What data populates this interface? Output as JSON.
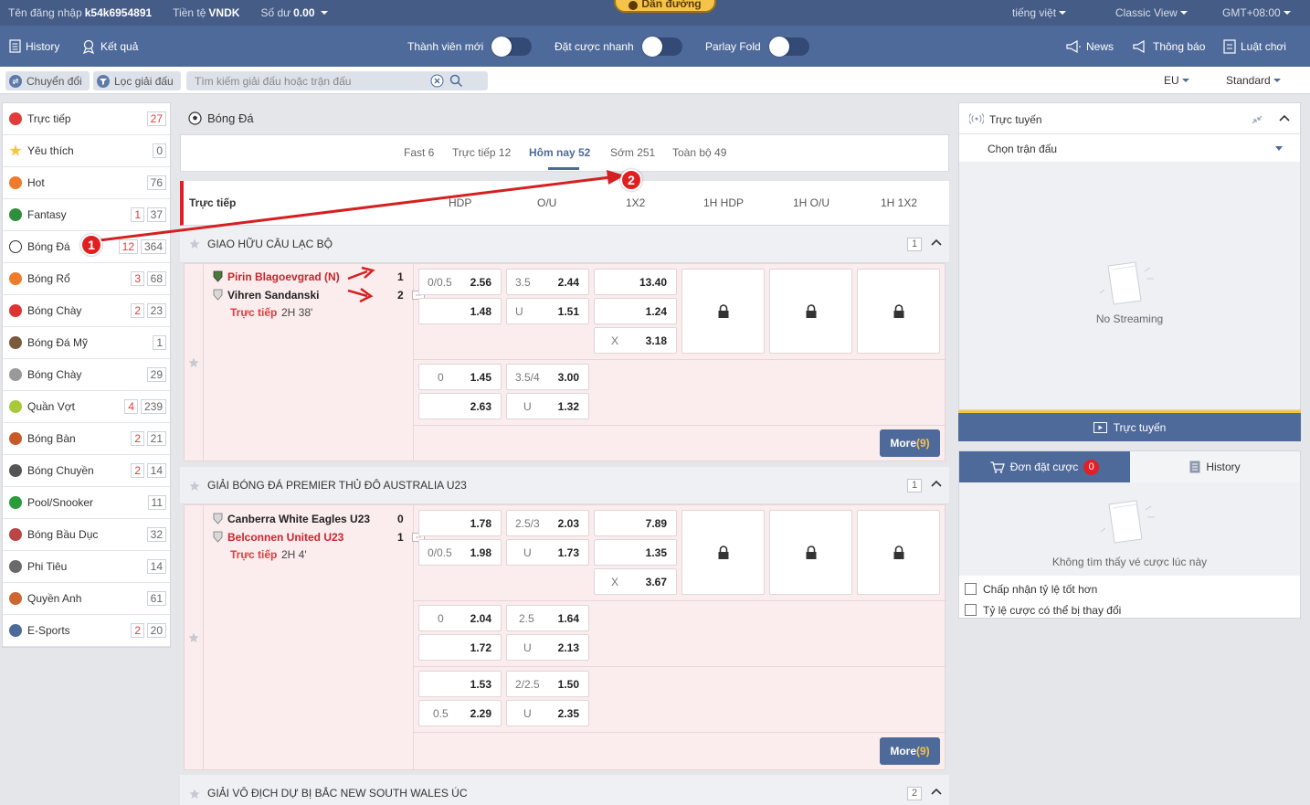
{
  "topbar": {
    "username_label": "Tên đăng nhập",
    "username": "k54k6954891",
    "currency_label": "Tiền tệ",
    "currency": "VNDK",
    "balance_label": "Số dư",
    "balance": "0.00",
    "guide": "Dẫn đường",
    "language": "tiếng việt",
    "view": "Classic View",
    "timezone": "GMT+08:00"
  },
  "nav": {
    "history": "History",
    "results": "Kết quả",
    "new_member": "Thành viên mới",
    "quick_bet": "Đặt cược nhanh",
    "parlay_fold": "Parlay Fold",
    "news": "News",
    "notices": "Thông báo",
    "rules": "Luật chơi"
  },
  "filter": {
    "switch": "Chuyển đổi",
    "filter_league": "Lọc giải đấu",
    "search_placeholder": "Tìm kiếm giải đấu hoặc trận đấu",
    "odds_format": "EU",
    "view_mode": "Standard"
  },
  "sidebar": [
    {
      "label": "Trực tiếp",
      "live": "",
      "total": "27",
      "live_only_red": true
    },
    {
      "label": "Yêu thích",
      "live": "",
      "total": "0"
    },
    {
      "label": "Hot",
      "live": "",
      "total": "76"
    },
    {
      "label": "Fantasy",
      "live": "1",
      "total": "37"
    },
    {
      "label": "Bóng Đá",
      "live": "12",
      "total": "364"
    },
    {
      "label": "Bóng Rổ",
      "live": "3",
      "total": "68"
    },
    {
      "label": "Bóng Chày",
      "live": "2",
      "total": "23"
    },
    {
      "label": "Bóng Đá Mỹ",
      "live": "",
      "total": "1"
    },
    {
      "label": "Bóng Chày",
      "live": "",
      "total": "29"
    },
    {
      "label": "Quần Vợt",
      "live": "4",
      "total": "239"
    },
    {
      "label": "Bóng Bàn",
      "live": "2",
      "total": "21"
    },
    {
      "label": "Bóng Chuyền",
      "live": "2",
      "total": "14"
    },
    {
      "label": "Pool/Snooker",
      "live": "",
      "total": "11"
    },
    {
      "label": "Bóng Bầu Dục",
      "live": "",
      "total": "32"
    },
    {
      "label": "Phi Tiêu",
      "live": "",
      "total": "14"
    },
    {
      "label": "Quyền Anh",
      "live": "",
      "total": "61"
    },
    {
      "label": "E-Sports",
      "live": "2",
      "total": "20"
    }
  ],
  "main": {
    "sport_title": "Bóng Đá",
    "tabs": [
      "Fast 6",
      "Trực tiếp 12",
      "Hôm nay 52",
      "Sớm 251",
      "Toàn bộ 49"
    ],
    "active_tab": "Hôm nay 52",
    "section": "Trực tiếp",
    "columns": [
      "HDP",
      "O/U",
      "1X2",
      "1H HDP",
      "1H O/U",
      "1H 1X2"
    ],
    "leagues": [
      {
        "name": "GIAO HỮU CÂU LẠC BỘ",
        "count": "1"
      },
      {
        "name": "GIẢI BÓNG ĐÁ PREMIER THỦ ĐÔ AUSTRALIA U23",
        "count": "1"
      },
      {
        "name": "GIẢI VÔ ĐỊCH DỰ BỊ BẮC NEW SOUTH WALES ÚC",
        "count": "2"
      }
    ],
    "match1": {
      "home": "Pirin Blagoevgrad (N)",
      "away": "Vihren Sandanski",
      "home_score": "1",
      "away_score": "2",
      "live": "Trực tiếp",
      "time": "2H 38'",
      "r1": {
        "hdp_h": "0/0.5",
        "hdp_a": "2.56",
        "ou_h": "3.5",
        "ou_a": "2.44",
        "x1": "13.40"
      },
      "r2": {
        "hdp_a": "1.48",
        "ou_h": "U",
        "ou_a": "1.51",
        "x2": "1.24"
      },
      "r3": {
        "xh": "X",
        "x": "3.18"
      },
      "r4": {
        "hdp_h": "0",
        "hdp_a": "1.45",
        "ou_h": "3.5/4",
        "ou_a": "3.00"
      },
      "r5": {
        "hdp_a": "2.63",
        "ou_h": "U",
        "ou_a": "1.32"
      },
      "more": "More",
      "more_count": "(9)"
    },
    "match2": {
      "home": "Canberra White Eagles U23",
      "away": "Belconnen United U23",
      "home_score": "0",
      "away_score": "1",
      "live": "Trực tiếp",
      "time": "2H 4'",
      "r1": {
        "hdp_a": "1.78",
        "ou_h": "2.5/3",
        "ou_a": "2.03",
        "x1": "7.89"
      },
      "r2": {
        "hdp_h": "0/0.5",
        "hdp_a": "1.98",
        "ou_h": "U",
        "ou_a": "1.73",
        "x2": "1.35"
      },
      "r3": {
        "xh": "X",
        "x": "3.67"
      },
      "r4": {
        "hdp_h": "0",
        "hdp_a": "2.04",
        "ou_h": "2.5",
        "ou_a": "1.64"
      },
      "r5": {
        "hdp_a": "1.72",
        "ou_h": "U",
        "ou_a": "2.13"
      },
      "r6": {
        "hdp_a": "1.53",
        "ou_h": "2/2.5",
        "ou_a": "1.50"
      },
      "r7": {
        "hdp_h": "0.5",
        "hdp_a": "2.29",
        "ou_h": "U",
        "ou_a": "2.35"
      },
      "more": "More",
      "more_count": "(9)"
    }
  },
  "right": {
    "live_title": "Trực tuyến",
    "select_match": "Chọn trận đấu",
    "no_streaming": "No Streaming",
    "live_button": "Trực tuyến",
    "betslip": "Đơn đặt cược",
    "betslip_count": "0",
    "history": "History",
    "no_tickets": "Không tìm thấy vé cược lúc này",
    "accept_better": "Chấp nhận tỷ lệ tốt hơn",
    "odds_may_change": "Tỷ lệ cược có thể bị thay đổi"
  },
  "annotations": [
    "1",
    "2"
  ],
  "colors": {
    "header": "#455c86",
    "nav": "#4e6a9b",
    "live_red": "#e23b3b",
    "accent_yellow": "#f5c443"
  }
}
